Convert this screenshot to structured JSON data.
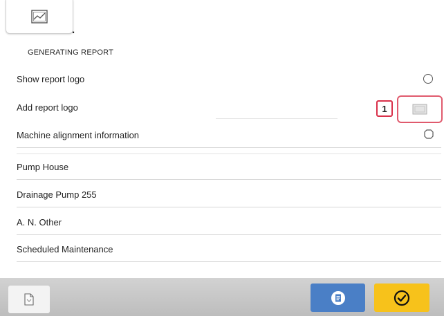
{
  "header": {
    "image_button_icon": "image-icon",
    "trailing_text": "."
  },
  "section": {
    "title": "GENERATING REPORT"
  },
  "options": {
    "show_report_logo": "Show report logo",
    "add_report_logo": "Add report logo",
    "machine_alignment_information": "Machine alignment information"
  },
  "callout": {
    "number": "1"
  },
  "fields": {
    "location": "Pump House",
    "machine": "Drainage Pump 255",
    "operator": "A. N. Other",
    "reason": "Scheduled Maintenance"
  },
  "footer": {
    "buttons": [
      "document-icon",
      "report-icon",
      "checkmark-icon"
    ]
  },
  "colors": {
    "accent_blue": "#4a7fc6",
    "accent_yellow": "#f7c21b",
    "callout_red": "#d9304a"
  }
}
